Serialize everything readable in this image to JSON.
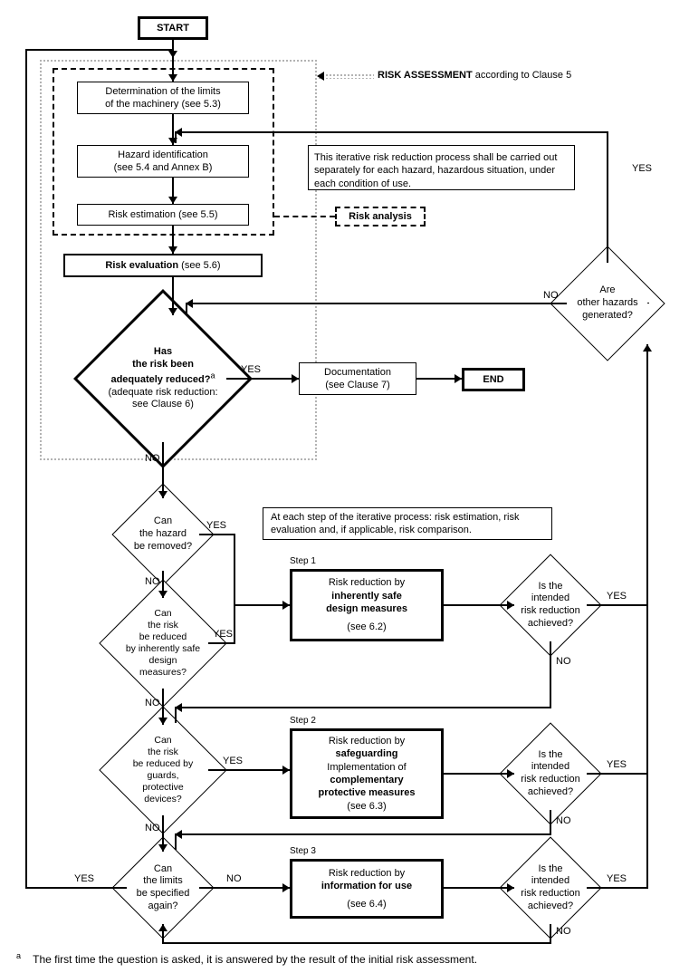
{
  "chart_data": {
    "type": "flowchart",
    "title": "RISK ASSESSMENT according to Clause 5",
    "nodes": [
      {
        "id": "start",
        "type": "terminator",
        "label": "START"
      },
      {
        "id": "limits",
        "type": "process",
        "label": "Determination of the limits of the machinery (see 5.3)"
      },
      {
        "id": "hazid",
        "type": "process",
        "label": "Hazard identification (see 5.4 and Annex B)"
      },
      {
        "id": "riskest",
        "type": "process",
        "label": "Risk estimation (see 5.5)"
      },
      {
        "id": "riskeval",
        "type": "process",
        "label": "Risk evaluation (see 5.6)"
      },
      {
        "id": "adequate",
        "type": "decision",
        "label": "Has the risk been adequately reduced? (adequate risk reduction: see Clause 6)"
      },
      {
        "id": "doc",
        "type": "process",
        "label": "Documentation (see Clause 7)"
      },
      {
        "id": "end",
        "type": "terminator",
        "label": "END"
      },
      {
        "id": "otherhaz",
        "type": "decision",
        "label": "Are other hazards generated?"
      },
      {
        "id": "hazremove",
        "type": "decision",
        "label": "Can the hazard be removed?"
      },
      {
        "id": "inherentq",
        "type": "decision",
        "label": "Can the risk be reduced by inherently safe design measures?"
      },
      {
        "id": "step1",
        "type": "process",
        "label": "Step 1: Risk reduction by inherently safe design measures (see 6.2)"
      },
      {
        "id": "ach1",
        "type": "decision",
        "label": "Is the intended risk reduction achieved?"
      },
      {
        "id": "guardsq",
        "type": "decision",
        "label": "Can the risk be reduced by guards, protective devices?"
      },
      {
        "id": "step2",
        "type": "process",
        "label": "Step 2: Risk reduction by safeguarding. Implementation of complementary protective measures (see 6.3)"
      },
      {
        "id": "ach2",
        "type": "decision",
        "label": "Is the intended risk reduction achieved?"
      },
      {
        "id": "limitsq",
        "type": "decision",
        "label": "Can the limits be specified again?"
      },
      {
        "id": "step3",
        "type": "process",
        "label": "Step 3: Risk reduction by information for use (see 6.4)"
      },
      {
        "id": "ach3",
        "type": "decision",
        "label": "Is the intended risk reduction achieved?"
      }
    ],
    "edges": [
      {
        "from": "start",
        "to": "limits"
      },
      {
        "from": "limits",
        "to": "hazid"
      },
      {
        "from": "hazid",
        "to": "riskest"
      },
      {
        "from": "riskest",
        "to": "riskeval"
      },
      {
        "from": "riskeval",
        "to": "adequate"
      },
      {
        "from": "adequate",
        "to": "doc",
        "label": "YES"
      },
      {
        "from": "doc",
        "to": "end"
      },
      {
        "from": "adequate",
        "to": "hazremove",
        "label": "NO"
      },
      {
        "from": "hazremove",
        "to": "step1",
        "label": "YES"
      },
      {
        "from": "hazremove",
        "to": "inherentq",
        "label": "NO"
      },
      {
        "from": "inherentq",
        "to": "step1",
        "label": "YES"
      },
      {
        "from": "inherentq",
        "to": "guardsq",
        "label": "NO"
      },
      {
        "from": "step1",
        "to": "ach1"
      },
      {
        "from": "ach1",
        "to": "otherhaz",
        "label": "YES"
      },
      {
        "from": "ach1",
        "to": "guardsq",
        "label": "NO"
      },
      {
        "from": "guardsq",
        "to": "step2",
        "label": "YES"
      },
      {
        "from": "guardsq",
        "to": "limitsq",
        "label": "NO"
      },
      {
        "from": "step2",
        "to": "ach2"
      },
      {
        "from": "ach2",
        "to": "otherhaz",
        "label": "YES"
      },
      {
        "from": "ach2",
        "to": "limitsq",
        "label": "NO"
      },
      {
        "from": "limitsq",
        "to": "limits",
        "label": "YES"
      },
      {
        "from": "limitsq",
        "to": "step3",
        "label": "NO"
      },
      {
        "from": "step3",
        "to": "ach3"
      },
      {
        "from": "ach3",
        "to": "otherhaz",
        "label": "YES"
      },
      {
        "from": "ach3",
        "to": "limitsq",
        "label": "NO"
      },
      {
        "from": "otherhaz",
        "to": "hazid",
        "label": "YES"
      },
      {
        "from": "otherhaz",
        "to": "adequate",
        "label": "NO"
      }
    ],
    "groups": [
      {
        "id": "risk_analysis",
        "label": "Risk analysis",
        "contains": [
          "limits",
          "hazid",
          "riskest"
        ]
      },
      {
        "id": "risk_assessment",
        "label": "RISK ASSESSMENT according to Clause 5",
        "contains": [
          "limits",
          "hazid",
          "riskest",
          "riskeval",
          "adequate"
        ]
      }
    ],
    "notes": [
      "This iterative risk reduction process shall be carried out separately for each hazard, hazardous situation, under each condition of use.",
      "At each step of the iterative process: risk estimation, risk evaluation and, if applicable, risk comparison."
    ],
    "footnote": "a  The first time the question is asked, it is answered by the result of the initial risk assessment."
  },
  "t": {
    "start": "START",
    "limits_l1": "Determination of the limits",
    "limits_l2": "of the machinery (see 5.3)",
    "hazid_l1": "Hazard identification",
    "hazid_l2": "(see 5.4 and Annex B)",
    "riskest": "Risk estimation (see 5.5)",
    "riskeval_b": "Risk evaluation",
    "riskeval_r": " (see 5.6)",
    "risk_analysis": "Risk analysis",
    "risk_assessment_b": "RISK ASSESSMENT",
    "risk_assessment_r": " according to Clause 5",
    "note1": "This iterative risk reduction process shall be carried out separately for each hazard, hazardous situation, under each condition of use.",
    "adequate_l1": "Has",
    "adequate_l2": "the risk been",
    "adequate_l3": "adequately reduced?",
    "adequate_l4": "(adequate risk reduction:",
    "adequate_l5": "see Clause 6)",
    "doc_l1": "Documentation",
    "doc_l2": "(see Clause 7)",
    "end": "END",
    "otherhaz_l1": "Are",
    "otherhaz_l2": "other hazards",
    "otherhaz_l3": "generated?",
    "yes": "YES",
    "no": "NO",
    "note2": "At each step of the iterative process: risk estimation, risk evaluation and, if applicable, risk comparison.",
    "hazremove_l1": "Can",
    "hazremove_l2": "the hazard",
    "hazremove_l3": "be removed?",
    "inherentq_l1": "Can",
    "inherentq_l2": "the risk",
    "inherentq_l3": "be reduced",
    "inherentq_l4": "by inherently safe",
    "inherentq_l5": "design",
    "inherentq_l6": "measures?",
    "step1": "Step 1",
    "step1_l1": "Risk reduction by",
    "step1_l2": "inherently safe",
    "step1_l3": "design measures",
    "step1_l4": "(see 6.2)",
    "ach_l1": "Is the",
    "ach_l2": "intended",
    "ach_l3": "risk reduction",
    "ach_l4": "achieved?",
    "guardsq_l1": "Can",
    "guardsq_l2": "the risk",
    "guardsq_l3": "be reduced by guards,",
    "guardsq_l4": "protective",
    "guardsq_l5": "devices?",
    "step2": "Step 2",
    "step2_l1": "Risk reduction by",
    "step2_l2": "safeguarding",
    "step2_l3": "Implementation of",
    "step2_l4": "complementary",
    "step2_l5": "protective measures",
    "step2_l6": "(see 6.3)",
    "limitsq_l1": "Can",
    "limitsq_l2": "the limits",
    "limitsq_l3": "be specified",
    "limitsq_l4": "again?",
    "step3": "Step 3",
    "step3_l1": "Risk reduction by",
    "step3_l2": "information for use",
    "step3_l3": "(see 6.4)",
    "foot_a": "a",
    "foot_txt": "The first time the question is asked, it is answered by the result of the initial risk assessment."
  }
}
